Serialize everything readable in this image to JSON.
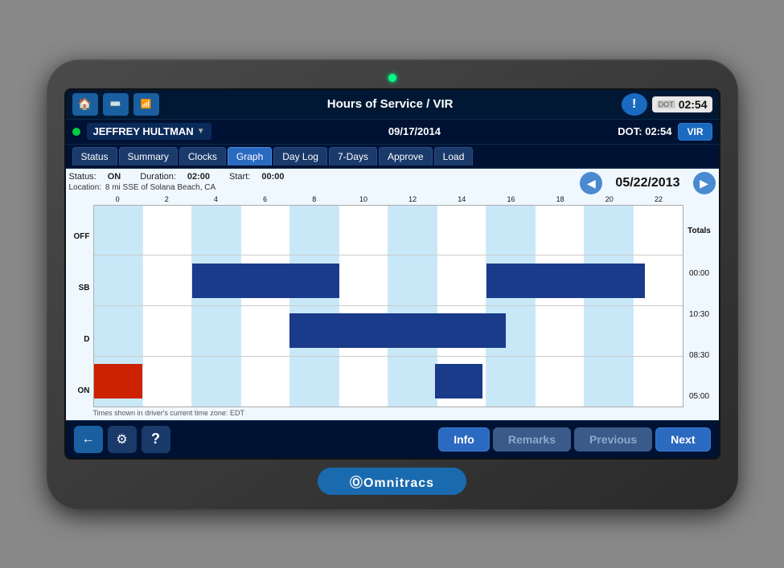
{
  "device": {
    "brand": "Omnitracs",
    "indicator_color": "#00ff88"
  },
  "header": {
    "home_icon": "🏠",
    "keyboard_icon": "⌨",
    "signal_icon": "📶",
    "title": "Hours of Service / VIR",
    "alert_icon": "!",
    "dot_label": "DOT",
    "dot_time": "02:54"
  },
  "driver_row": {
    "driver_name": "JEFFREY HULTMAN",
    "date": "09/17/2014",
    "dot_label": "DOT:",
    "dot_time": "02:54",
    "vir_label": "VIR"
  },
  "tabs": [
    {
      "label": "Status",
      "active": false
    },
    {
      "label": "Summary",
      "active": false
    },
    {
      "label": "Clocks",
      "active": false
    },
    {
      "label": "Graph",
      "active": true
    },
    {
      "label": "Day Log",
      "active": false
    },
    {
      "label": "7-Days",
      "active": false
    },
    {
      "label": "Approve",
      "active": false
    },
    {
      "label": "Load",
      "active": false
    }
  ],
  "graph": {
    "status_label": "Status:",
    "status_value": "ON",
    "duration_label": "Duration:",
    "duration_value": "02:00",
    "start_label": "Start:",
    "start_value": "00:00",
    "location_label": "Location:",
    "location_value": "8 mi SSE of Solana Beach, CA",
    "date": "05/22/2013",
    "hour_labels": [
      "0",
      "2",
      "4",
      "6",
      "8",
      "10",
      "12",
      "14",
      "16",
      "18",
      "20",
      "22"
    ],
    "row_labels": [
      "OFF",
      "SB",
      "D",
      "ON"
    ],
    "totals_header": "Totals",
    "totals": [
      "00:00",
      "10:30",
      "08:30",
      "05:00"
    ],
    "timezone_note": "Times shown in driver's current time zone:  EDT"
  },
  "bottom_buttons": {
    "back_icon": "←",
    "settings_icon": "⚙",
    "help_icon": "?",
    "info_label": "Info",
    "remarks_label": "Remarks",
    "previous_label": "Previous",
    "next_label": "Next"
  }
}
